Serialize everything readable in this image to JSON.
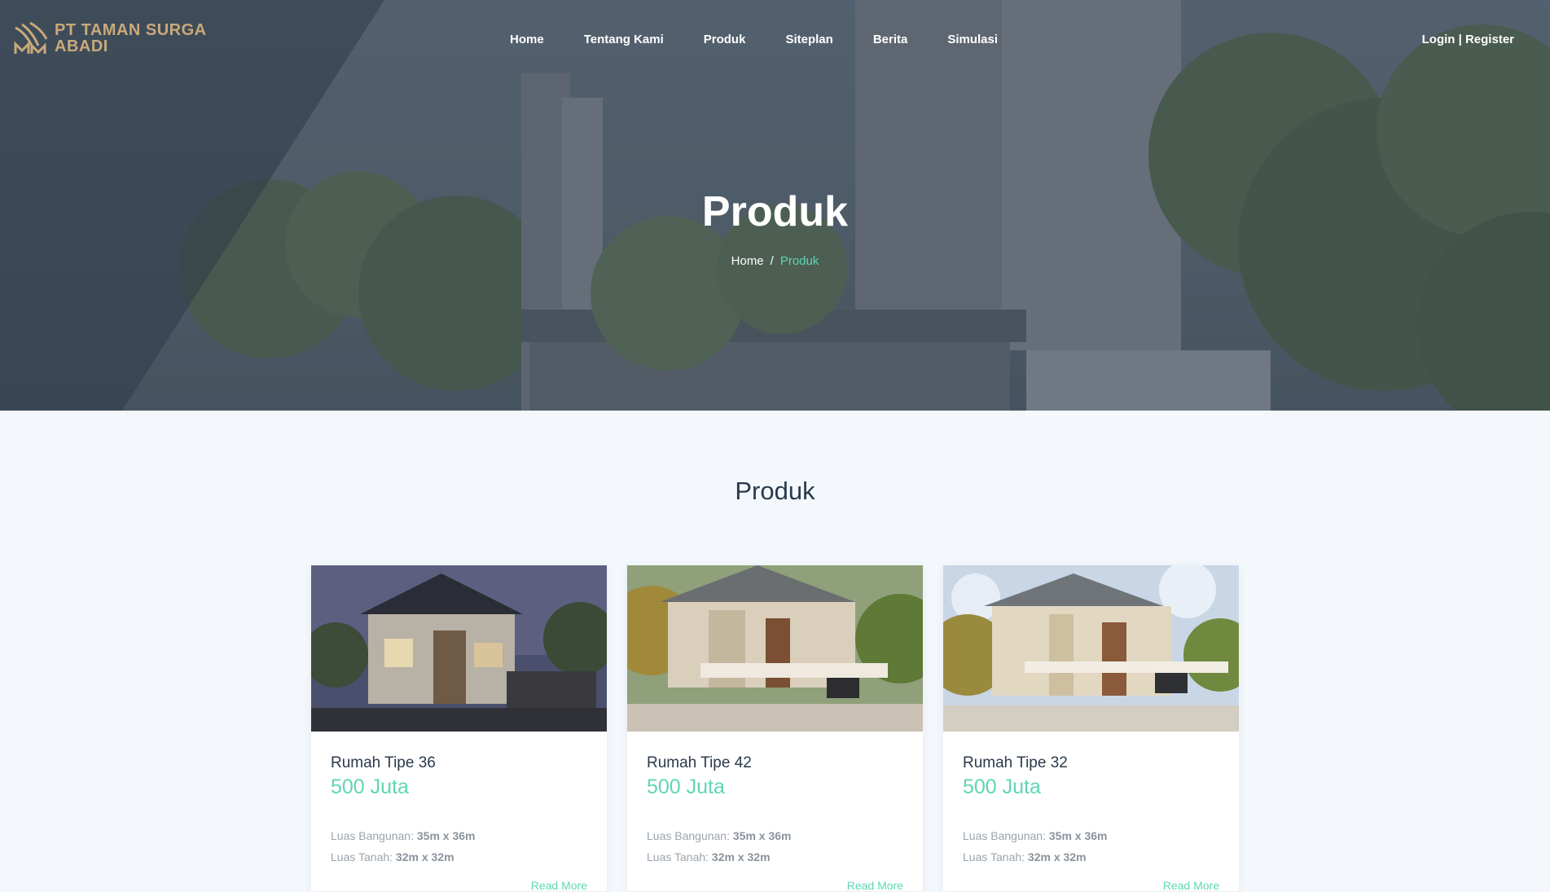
{
  "brand": {
    "name_line1": "PT TAMAN SURGA",
    "name_line2": "ABADI",
    "color": "#c9a97a"
  },
  "nav": {
    "items": [
      "Home",
      "Tentang Kami",
      "Produk",
      "Siteplan",
      "Berita",
      "Simulasi"
    ],
    "auth": "Login | Register"
  },
  "hero": {
    "title": "Produk",
    "breadcrumb": {
      "home": "Home",
      "separator": "/",
      "current": "Produk"
    }
  },
  "section": {
    "title": "Produk"
  },
  "accent_color": "#5fd6b4",
  "products": [
    {
      "name": "Rumah Tipe 36",
      "price": "500 Juta",
      "luas_bangunan_label": "Luas Bangunan:",
      "luas_bangunan": "35m x 36m",
      "luas_tanah_label": "Luas Tanah:",
      "luas_tanah": "32m x 32m",
      "read_more": "Read More"
    },
    {
      "name": "Rumah Tipe 42",
      "price": "500 Juta",
      "luas_bangunan_label": "Luas Bangunan:",
      "luas_bangunan": "35m x 36m",
      "luas_tanah_label": "Luas Tanah:",
      "luas_tanah": "32m x 32m",
      "read_more": "Read More"
    },
    {
      "name": "Rumah Tipe 32",
      "price": "500 Juta",
      "luas_bangunan_label": "Luas Bangunan:",
      "luas_bangunan": "35m x 36m",
      "luas_tanah_label": "Luas Tanah:",
      "luas_tanah": "32m x 32m",
      "read_more": "Read More"
    }
  ]
}
